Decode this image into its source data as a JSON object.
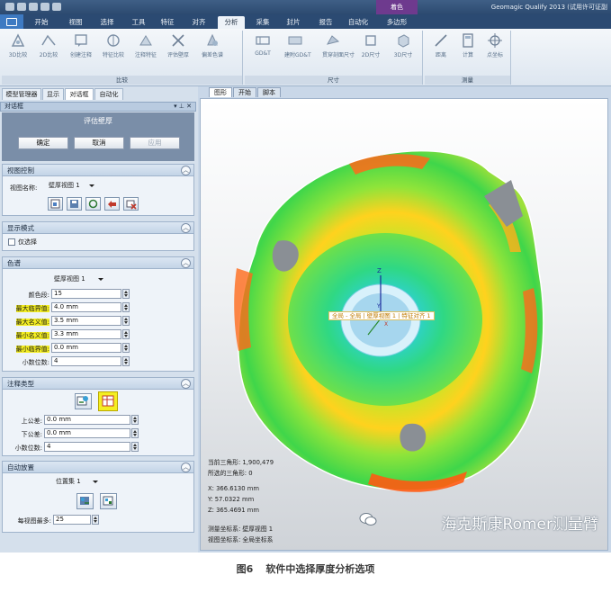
{
  "window": {
    "title": "Geomagic Qualify 2013 (试用许可证副",
    "context_tab": "着色"
  },
  "ribbon": {
    "tabs": [
      "开始",
      "视图",
      "选择",
      "工具",
      "特征",
      "对齐",
      "分析",
      "采集",
      "封片",
      "报告",
      "自动化",
      "多边形"
    ],
    "active_tab": "分析",
    "groups": [
      {
        "label": "比较",
        "buttons": [
          "3D比较",
          "2D比较",
          "创建注释",
          "特征比较",
          "注释特征",
          "评估壁厚",
          "偏差色谱"
        ]
      },
      {
        "label": "尺寸",
        "buttons": [
          "GD&T",
          "建附GD&T",
          "贯穿剖面尺寸",
          "2D尺寸",
          "3D尺寸"
        ]
      },
      {
        "label": "测量",
        "buttons": [
          "距离",
          "计算",
          "点坐标"
        ]
      }
    ]
  },
  "left_panel": {
    "tabs": [
      "模型管理器",
      "显示",
      "对话框",
      "自动化"
    ],
    "active_tab": "对话框",
    "header": "对话框",
    "dialog_title": "评估壁厚",
    "buttons": {
      "ok": "确定",
      "cancel": "取消",
      "apply": "应用"
    },
    "view_control": {
      "title": "视图控制",
      "view_name_label": "视图名称:",
      "view_name_value": "壁厚视图 1"
    },
    "display_mode": {
      "title": "显示模式",
      "only_selected_label": "仅选择"
    },
    "color_spectrum": {
      "title": "色谱",
      "spectrum_value": "壁厚视图 1",
      "color_segments_label": "颜色段:",
      "color_segments_value": "15",
      "max_critical_label": "最大临界值:",
      "max_critical_value": "4.0 mm",
      "max_nominal_label": "最大名义值:",
      "max_nominal_value": "3.5 mm",
      "min_nominal_label": "最小名义值:",
      "min_nominal_value": "3.3 mm",
      "min_critical_label": "最小临界值:",
      "min_critical_value": "0.0 mm",
      "decimals_label": "小数位数:",
      "decimals_value": "4"
    },
    "annotation_type": {
      "title": "注释类型",
      "upper_tol_label": "上公差:",
      "upper_tol_value": "0.0 mm",
      "lower_tol_label": "下公差:",
      "lower_tol_value": "0.0 mm",
      "decimals_label": "小数位数:",
      "decimals_value": "4"
    },
    "auto_placement": {
      "title": "自动放置",
      "position_set_value": "位置集 1",
      "per_view_max_label": "每视图最多:",
      "per_view_max_value": "25"
    }
  },
  "viewport": {
    "tabs": [
      "图形",
      "开始",
      "脚本"
    ],
    "active_tab": "图形",
    "axis_label_z": "Z",
    "axis_label_y": "Y",
    "axis_label_x": "X",
    "coordinate_tag": "全局 - 全局 | 壁厚视图 1 | 特征对齐 1",
    "info": {
      "current_triangles": "当前三角形: 1,900,479",
      "selected_triangles": "所选的三角形: 0",
      "x": "X:  366.6130 mm",
      "y": "Y:  57.0322 mm",
      "z": "Z:  365.4691 mm",
      "measure_coord": "测量坐标系: 壁厚视图 1",
      "view_coord": "视图坐标系: 全局坐标系"
    },
    "watermark": "海克斯康Romer测量臂"
  },
  "caption": {
    "number": "图6",
    "text": "软件中选择厚度分析选项"
  },
  "colors": {
    "titlebar": "#2c4a70",
    "ribbon_tabbar": "#2b4a72",
    "panel_bg": "#d5e0ec",
    "dialog_bar": "#7a8ea8",
    "highlight": "#f4ee22",
    "context_tab": "#6e3a8e"
  }
}
